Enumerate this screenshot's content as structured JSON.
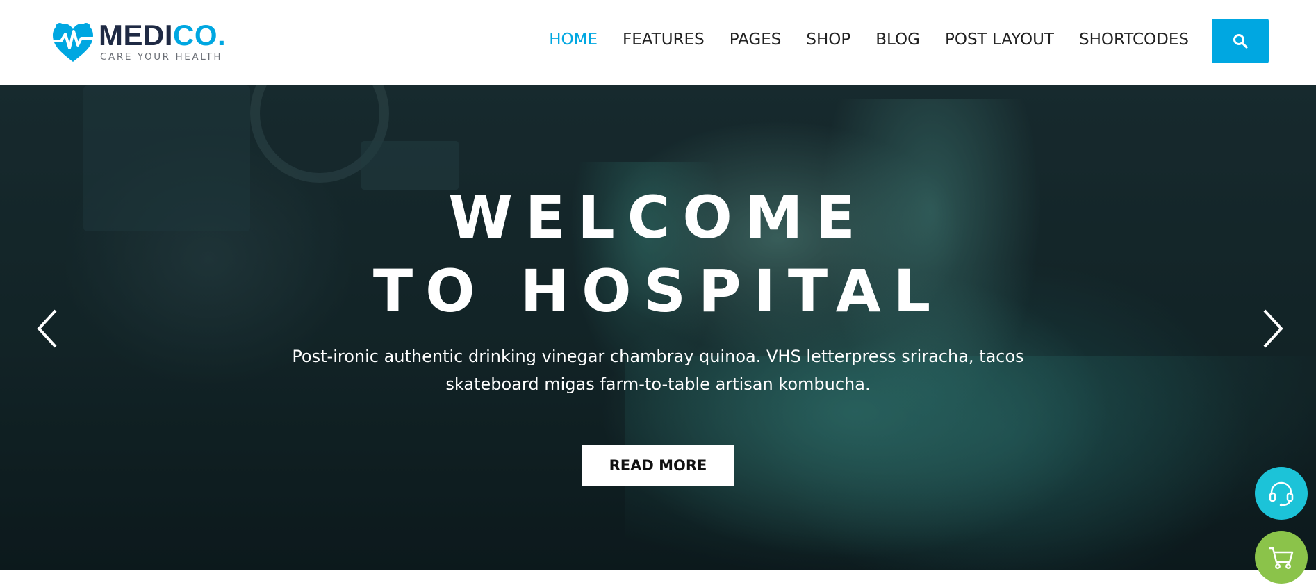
{
  "brand": {
    "name_main": "MEDI",
    "name_accent": "CO.",
    "tagline": "CARE YOUR HEALTH",
    "accent_color": "#00a7e1",
    "dark_color": "#1f2a44"
  },
  "nav": {
    "items": [
      {
        "label": "HOME",
        "active": true
      },
      {
        "label": "FEATURES",
        "active": false
      },
      {
        "label": "PAGES",
        "active": false
      },
      {
        "label": "SHOP",
        "active": false
      },
      {
        "label": "BLOG",
        "active": false
      },
      {
        "label": "POST LAYOUT",
        "active": false
      },
      {
        "label": "SHORTCODES",
        "active": false
      }
    ],
    "search_icon": "search-icon"
  },
  "hero": {
    "title_line1": "WELCOME",
    "title_line2": "TO HOSPITAL",
    "description_line1": "Post-ironic authentic drinking vinegar chambray quinoa. VHS letterpress sriracha, tacos",
    "description_line2": "skateboard migas farm-to-table artisan kombucha.",
    "button_label": "READ MORE",
    "prev_icon": "chevron-left-icon",
    "next_icon": "chevron-right-icon"
  },
  "floating": {
    "support_icon": "headset-icon",
    "support_color": "#1cc3d8",
    "cart_icon": "cart-icon",
    "cart_color": "#8bc34a"
  }
}
